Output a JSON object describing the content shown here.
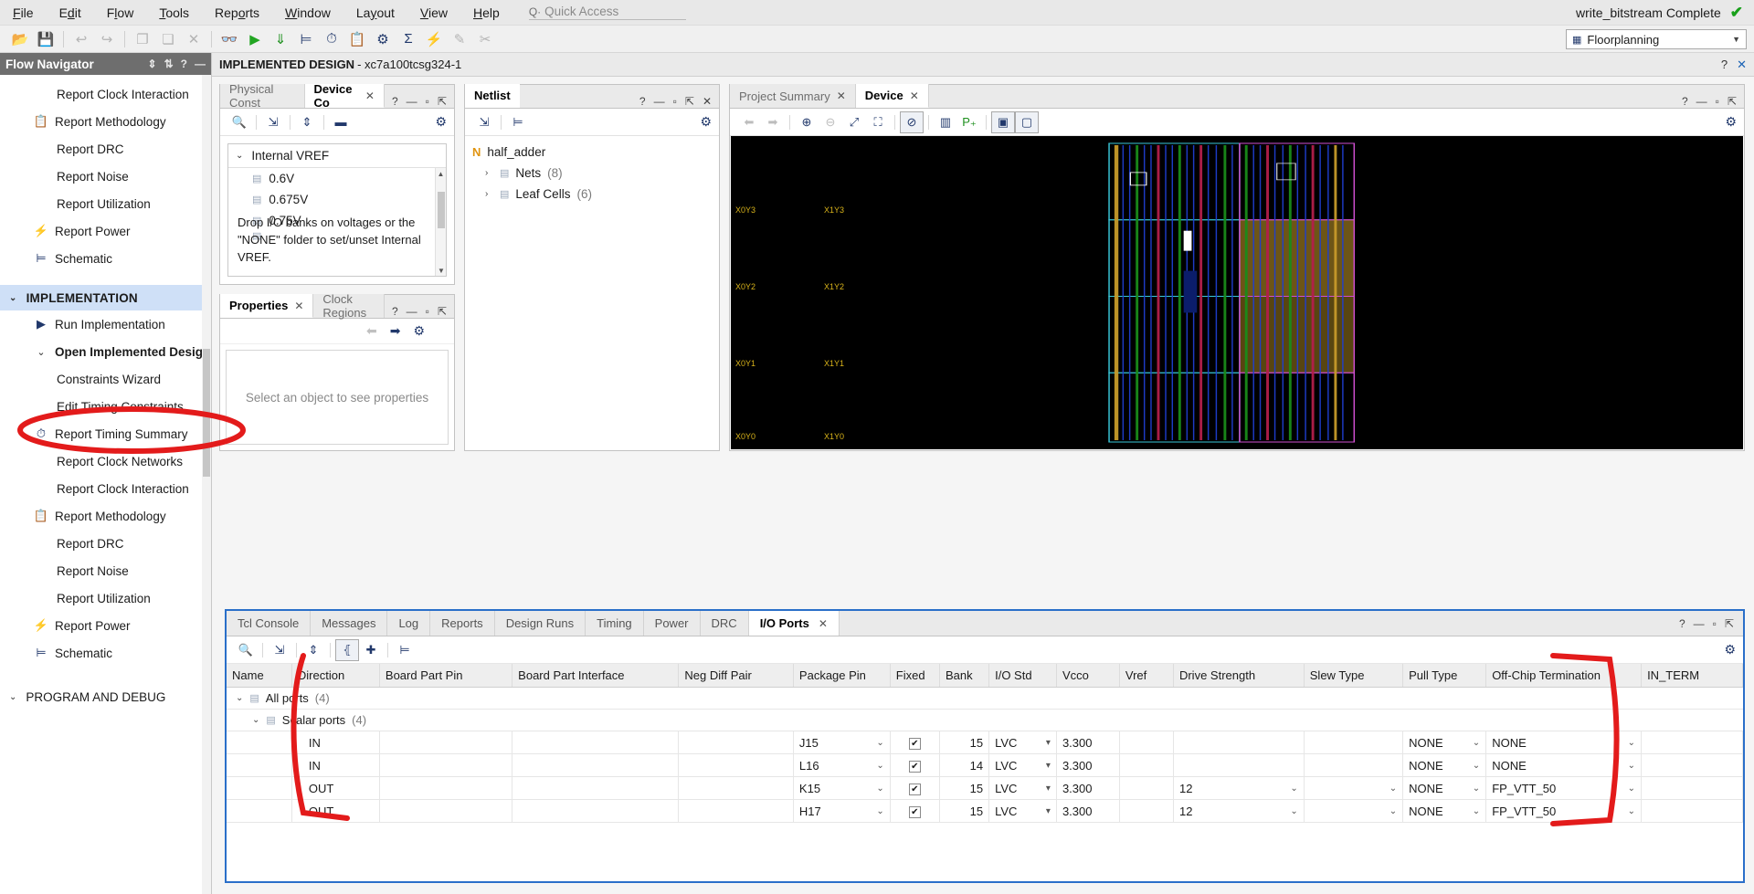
{
  "menu": {
    "items": [
      "File",
      "Edit",
      "Flow",
      "Tools",
      "Reports",
      "Window",
      "Layout",
      "View",
      "Help"
    ],
    "quick_access_placeholder": "Quick Access",
    "status_text": "write_bitstream Complete",
    "status_icon": "check-icon"
  },
  "toolbar": {
    "layout_label": "Floorplanning",
    "buttons": [
      "open-icon",
      "save-icon",
      "undo-icon",
      "redo-icon",
      "copy-icon",
      "paste-icon",
      "delete-icon",
      "search-icon",
      "run-icon",
      "sort-icon",
      "schematic-icon",
      "timing-icon",
      "methodology-icon",
      "settings-icon",
      "sum-icon",
      "power-icon",
      "edit-icon",
      "cancel-icon"
    ]
  },
  "flow_navigator": {
    "title": "Flow Navigator",
    "items": [
      {
        "label": "Report Clock Interaction",
        "icon": "",
        "indent": "sub"
      },
      {
        "label": "Report Methodology",
        "icon": "clipboard-icon",
        "indent": "icon"
      },
      {
        "label": "Report DRC",
        "icon": "",
        "indent": "sub"
      },
      {
        "label": "Report Noise",
        "icon": "",
        "indent": "sub"
      },
      {
        "label": "Report Utilization",
        "icon": "",
        "indent": "sub"
      },
      {
        "label": "Report Power",
        "icon": "power-icon",
        "indent": "icon"
      },
      {
        "label": "Schematic",
        "icon": "schematic-icon",
        "indent": "icon"
      }
    ],
    "section": {
      "label": "IMPLEMENTATION",
      "expanded": true
    },
    "impl_items": [
      {
        "label": "Run Implementation",
        "icon": "play-icon",
        "indent": "icon",
        "bold": false
      },
      {
        "label": "Open Implemented Design",
        "icon": "chevron-down-icon",
        "indent": "icon",
        "bold": true
      },
      {
        "label": "Constraints Wizard",
        "icon": "",
        "indent": "sub",
        "bold": false
      },
      {
        "label": "Edit Timing Constraints",
        "icon": "",
        "indent": "sub",
        "bold": false
      },
      {
        "label": "Report Timing Summary",
        "icon": "timing-icon",
        "indent": "icon",
        "bold": false
      },
      {
        "label": "Report Clock Networks",
        "icon": "",
        "indent": "sub",
        "bold": false
      },
      {
        "label": "Report Clock Interaction",
        "icon": "",
        "indent": "sub",
        "bold": false
      },
      {
        "label": "Report Methodology",
        "icon": "clipboard-icon",
        "indent": "icon",
        "bold": false
      },
      {
        "label": "Report DRC",
        "icon": "",
        "indent": "sub",
        "bold": false
      },
      {
        "label": "Report Noise",
        "icon": "",
        "indent": "sub",
        "bold": false
      },
      {
        "label": "Report Utilization",
        "icon": "",
        "indent": "sub",
        "bold": false
      },
      {
        "label": "Report Power",
        "icon": "power-icon",
        "indent": "icon",
        "bold": false
      },
      {
        "label": "Schematic",
        "icon": "schematic-icon",
        "indent": "icon",
        "bold": false
      }
    ],
    "bottom_section": {
      "label": "PROGRAM AND DEBUG",
      "expanded": true
    }
  },
  "design_bar": {
    "title": "IMPLEMENTED DESIGN",
    "subtitle": "- xc7a100tcsg324-1",
    "help": "?",
    "close": "✕"
  },
  "device_constraints": {
    "tabs": [
      {
        "label": "Physical Const",
        "active": false,
        "closable": false
      },
      {
        "label": "Device Co",
        "active": true,
        "closable": true
      }
    ],
    "root": "Internal VREF",
    "voltages": [
      "0.6V",
      "0.675V",
      "0.75V"
    ],
    "hint": "Drop I/O banks on voltages or the \"NONE\" folder to set/unset Internal VREF."
  },
  "properties_panel": {
    "tabs": [
      {
        "label": "Properties",
        "active": true,
        "closable": true
      },
      {
        "label": "Clock Regions",
        "active": false,
        "closable": false
      }
    ],
    "empty_text": "Select an object to see properties"
  },
  "netlist": {
    "title": "Netlist",
    "top": "half_adder",
    "children": [
      {
        "label": "Nets",
        "count": "(8)"
      },
      {
        "label": "Leaf Cells",
        "count": "(6)"
      }
    ]
  },
  "device_view": {
    "tabs": [
      {
        "label": "Project Summary",
        "active": false,
        "closable": true
      },
      {
        "label": "Device",
        "active": true,
        "closable": true
      }
    ],
    "clock_regions": [
      "X0Y3",
      "X1Y3",
      "X0Y2",
      "X1Y2",
      "X0Y1",
      "X1Y1",
      "X0Y0",
      "X1Y0"
    ]
  },
  "console": {
    "tabs": [
      {
        "label": "Tcl Console",
        "active": false,
        "closable": false
      },
      {
        "label": "Messages",
        "active": false,
        "closable": false
      },
      {
        "label": "Log",
        "active": false,
        "closable": false
      },
      {
        "label": "Reports",
        "active": false,
        "closable": false
      },
      {
        "label": "Design Runs",
        "active": false,
        "closable": false
      },
      {
        "label": "Timing",
        "active": false,
        "closable": false
      },
      {
        "label": "Power",
        "active": false,
        "closable": false
      },
      {
        "label": "DRC",
        "active": false,
        "closable": false
      },
      {
        "label": "I/O Ports",
        "active": true,
        "closable": true
      }
    ]
  },
  "io_ports": {
    "columns": [
      "Name",
      "Direction",
      "Board Part Pin",
      "Board Part Interface",
      "Neg Diff Pair",
      "Package Pin",
      "Fixed",
      "Bank",
      "I/O Std",
      "Vcco",
      "Vref",
      "Drive Strength",
      "Slew Type",
      "Pull Type",
      "Off-Chip Termination",
      "IN_TERM"
    ],
    "groups": [
      {
        "label": "All ports",
        "count": "(4)",
        "level": 0
      },
      {
        "label": "Scalar ports",
        "count": "(4)",
        "level": 1
      }
    ],
    "rows": [
      {
        "name": "",
        "direction": "IN",
        "board_part_pin": "",
        "board_part_interface": "",
        "neg_diff_pair": "",
        "package_pin": "J15",
        "fixed": true,
        "bank": "15",
        "io_std": "LVC",
        "vcco": "3.300",
        "vref": "",
        "drive_strength": "",
        "slew_type": "",
        "pull_type": "NONE",
        "off_chip_termination": "NONE",
        "in_term": ""
      },
      {
        "name": "",
        "direction": "IN",
        "board_part_pin": "",
        "board_part_interface": "",
        "neg_diff_pair": "",
        "package_pin": "L16",
        "fixed": true,
        "bank": "14",
        "io_std": "LVC",
        "vcco": "3.300",
        "vref": "",
        "drive_strength": "",
        "slew_type": "",
        "pull_type": "NONE",
        "off_chip_termination": "NONE",
        "in_term": ""
      },
      {
        "name": "",
        "direction": "OUT",
        "board_part_pin": "",
        "board_part_interface": "",
        "neg_diff_pair": "",
        "package_pin": "K15",
        "fixed": true,
        "bank": "15",
        "io_std": "LVC",
        "vcco": "3.300",
        "vref": "",
        "drive_strength": "12",
        "slew_type": "",
        "pull_type": "NONE",
        "off_chip_termination": "FP_VTT_50",
        "in_term": ""
      },
      {
        "name": "",
        "direction": "OUT",
        "board_part_pin": "",
        "board_part_interface": "",
        "neg_diff_pair": "",
        "package_pin": "H17",
        "fixed": true,
        "bank": "15",
        "io_std": "LVC",
        "vcco": "3.300",
        "vref": "",
        "drive_strength": "12",
        "slew_type": "",
        "pull_type": "NONE",
        "off_chip_termination": "FP_VTT_50",
        "in_term": ""
      }
    ]
  },
  "colors": {
    "accent_blue": "#2a6fc9",
    "annotation_red": "#e31b1b",
    "section_blue": "#cfe0f7",
    "status_green": "#18a01a"
  }
}
